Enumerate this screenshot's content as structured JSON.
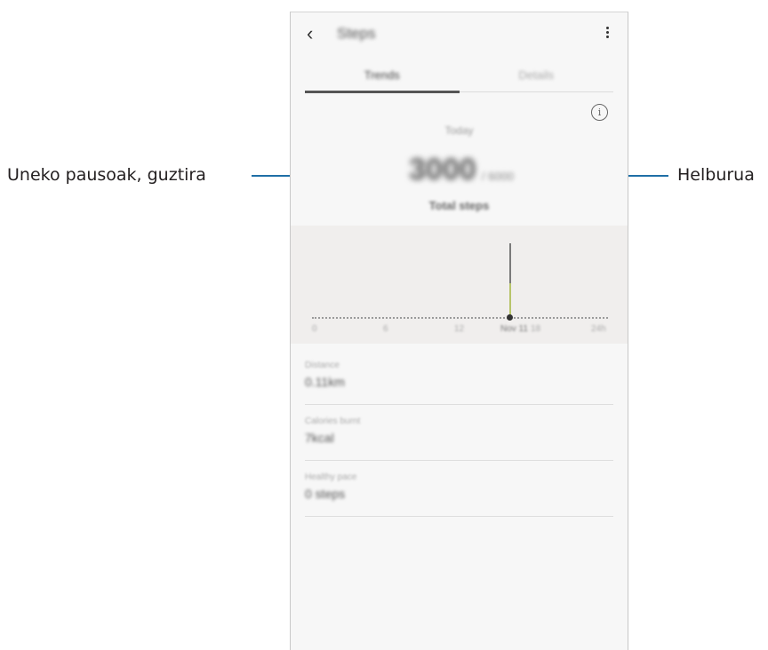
{
  "callouts": {
    "left": "Uneko pausoak, guztira",
    "right": "Helburua"
  },
  "app": {
    "title": "Steps",
    "back_icon": "arrow-back-icon",
    "more_icon": "more-vert-icon"
  },
  "tabs": [
    {
      "label": "Trends",
      "active": true
    },
    {
      "label": "Details",
      "active": false
    }
  ],
  "summary": {
    "day_label": "Today",
    "steps": "3000",
    "goal": "/ 6000",
    "total_label": "Total steps"
  },
  "graph": {
    "ticks": [
      "0",
      "6",
      "12",
      "Nov 11",
      "18",
      "24h"
    ]
  },
  "stats": [
    {
      "label": "Distance",
      "value": "0.11km"
    },
    {
      "label": "Calories burnt",
      "value": "7kcal"
    },
    {
      "label": "Healthy pace",
      "value": "0 steps"
    }
  ]
}
